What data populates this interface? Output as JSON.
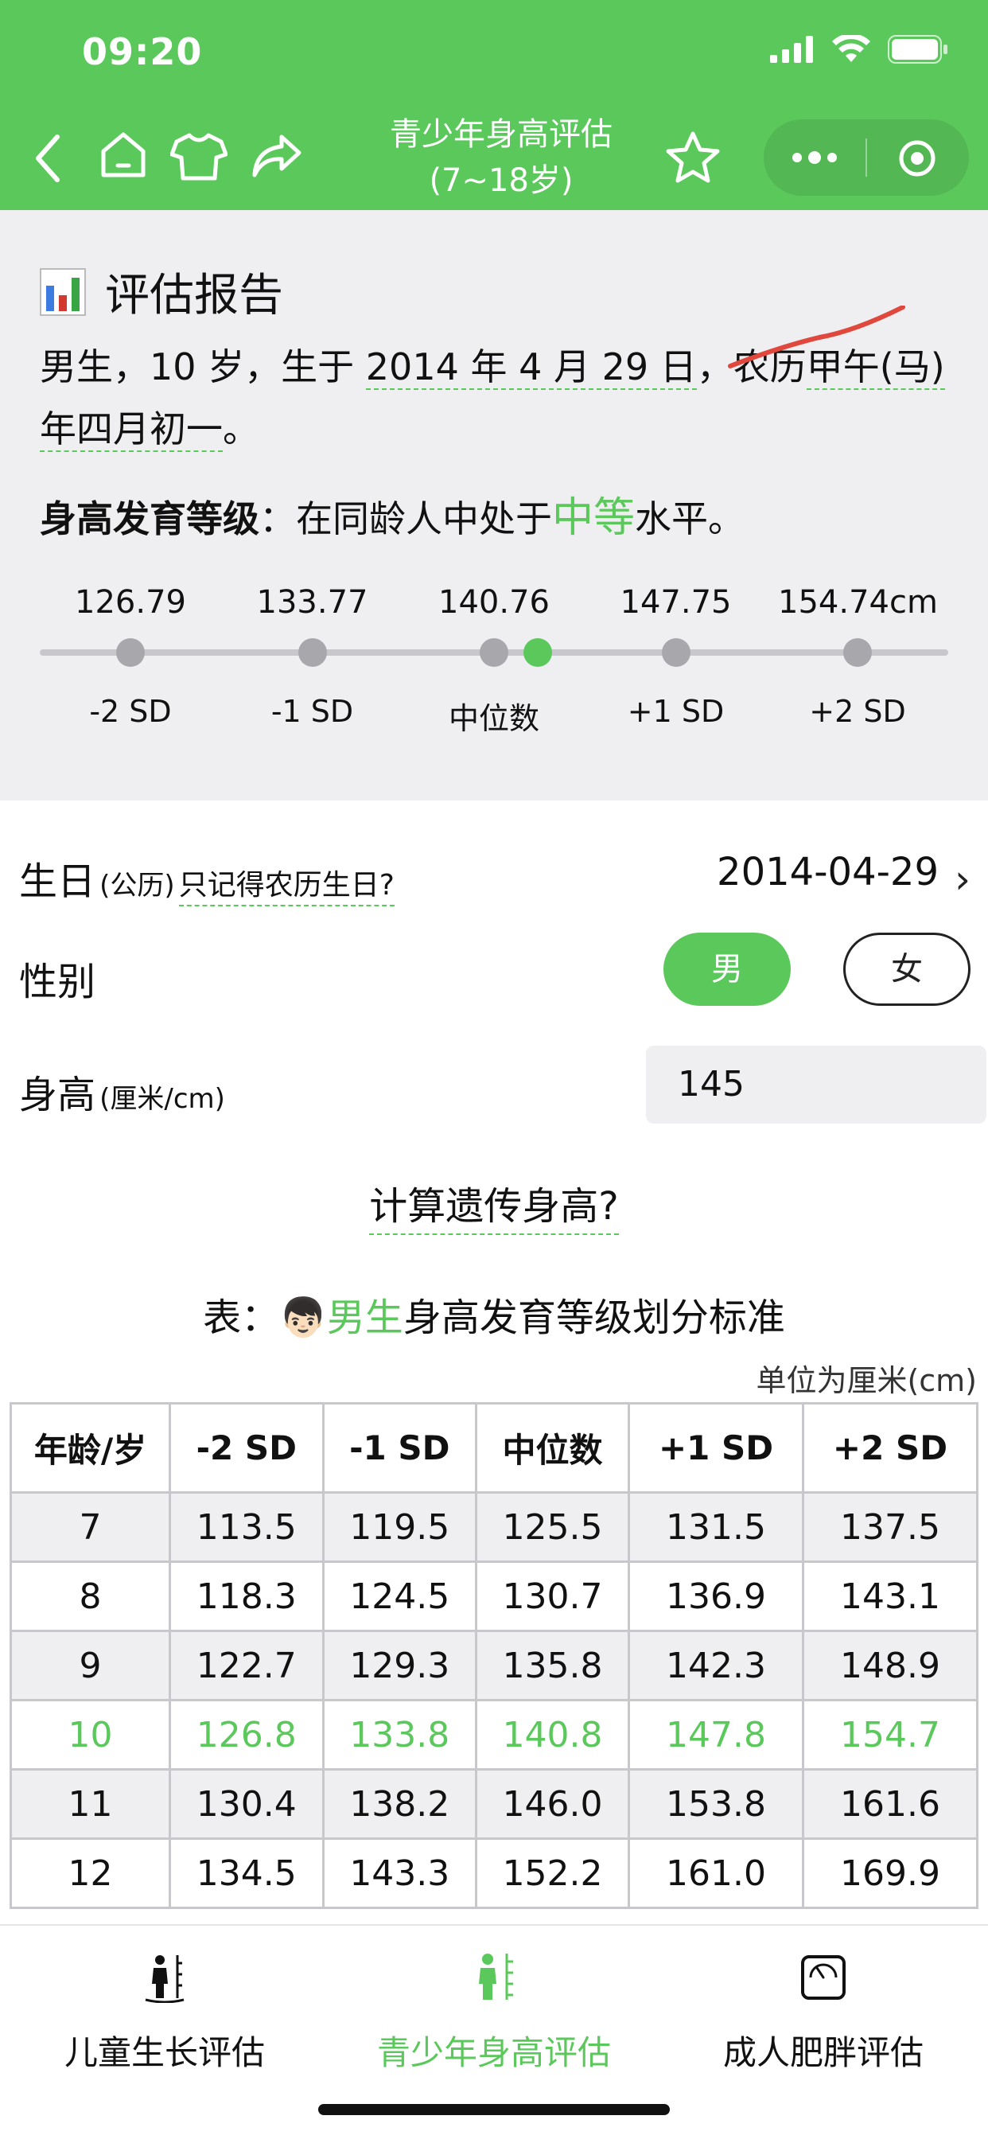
{
  "status": {
    "time": "09:20"
  },
  "nav": {
    "title_line1": "青少年身高评估",
    "title_line2": "(7~18岁)"
  },
  "report": {
    "title": "评估报告",
    "summary_lead": "男生，10 岁，生于 ",
    "summary_date": "2014 年 4 月 29 日",
    "summary_mid": "，农历",
    "summary_lunar": "甲午(马)年四月初一",
    "summary_end": "。",
    "grade_label": "身高发育等级",
    "grade_pre": "：在同龄人中处于",
    "grade_value": "中等",
    "grade_post": "水平。",
    "scale_values": [
      "126.79",
      "133.77",
      "140.76",
      "147.75",
      "154.74cm"
    ],
    "scale_labels": [
      "-2 SD",
      "-1 SD",
      "中位数",
      "+1 SD",
      "+2 SD"
    ],
    "current_fraction": 0.56
  },
  "form": {
    "birthday_label": "生日",
    "birthday_sub": "(公历)",
    "birthday_hint": "只记得农历生日?",
    "birthday_value": "2014-04-29",
    "gender_label": "性别",
    "gender_male": "男",
    "gender_female": "女",
    "height_label": "身高",
    "height_sub": "(厘米/cm)",
    "height_value": "145",
    "calc_link": "计算遗传身高?"
  },
  "table": {
    "title_pre": "表：",
    "title_emoji": "👦🏻",
    "title_green": "男生",
    "title_post": "身高发育等级划分标准",
    "unit": "单位为厘米(cm)",
    "headers": [
      "年龄/岁",
      "-2 SD",
      "-1 SD",
      "中位数",
      "+1 SD",
      "+2 SD"
    ],
    "rows": [
      [
        "7",
        "113.5",
        "119.5",
        "125.5",
        "131.5",
        "137.5"
      ],
      [
        "8",
        "118.3",
        "124.5",
        "130.7",
        "136.9",
        "143.1"
      ],
      [
        "9",
        "122.7",
        "129.3",
        "135.8",
        "142.3",
        "148.9"
      ],
      [
        "10",
        "126.8",
        "133.8",
        "140.8",
        "147.8",
        "154.7"
      ],
      [
        "11",
        "130.4",
        "138.2",
        "146.0",
        "153.8",
        "161.6"
      ],
      [
        "12",
        "134.5",
        "143.3",
        "152.2",
        "161.0",
        "169.9"
      ]
    ]
  },
  "tabs": [
    {
      "label": "儿童生长评估"
    },
    {
      "label": "青少年身高评估"
    },
    {
      "label": "成人肥胖评估"
    }
  ],
  "colors": {
    "accent": "#5bc85b",
    "panel": "#efeff2",
    "curve": "#e0483d"
  }
}
